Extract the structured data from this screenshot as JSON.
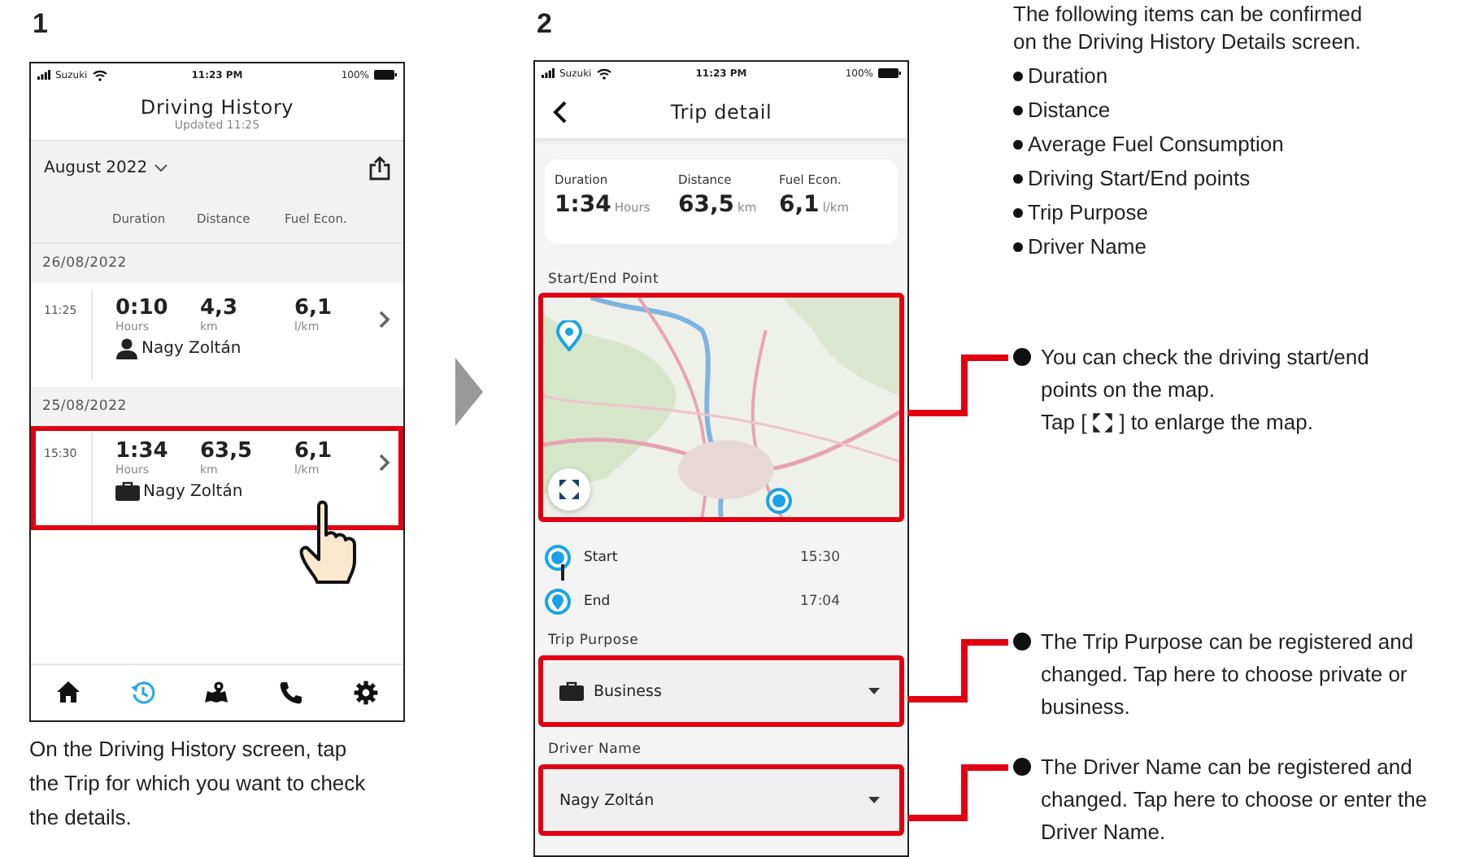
{
  "history_step": {
    "number": "1",
    "status_bar": {
      "carrier": "Suzuki",
      "time": "11:23 PM",
      "battery": "100%"
    },
    "title": "Driving History",
    "subtitle": "Updated 11:25",
    "month": "August 2022",
    "columns": [
      "Duration",
      "Distance",
      "Fuel Econ."
    ],
    "days": [
      {
        "date": "26/08/2022",
        "trips": [
          {
            "time": "11:25",
            "duration": "0:10",
            "duration_unit": "Hours",
            "distance": "4,3",
            "distance_unit": "km",
            "fuel": "6,1",
            "fuel_unit": "l/km",
            "kind": "private",
            "driver": "Nagy Zoltán",
            "highlighted": false
          }
        ]
      },
      {
        "date": "25/08/2022",
        "trips": [
          {
            "time": "15:30",
            "duration": "1:34",
            "duration_unit": "Hours",
            "distance": "63,5",
            "distance_unit": "km",
            "fuel": "6,1",
            "fuel_unit": "l/km",
            "kind": "business",
            "driver": "Nagy Zoltán",
            "highlighted": true
          }
        ]
      }
    ],
    "nav": [
      {
        "kind": "home",
        "selected": false
      },
      {
        "kind": "history",
        "selected": true
      },
      {
        "kind": "map",
        "selected": false
      },
      {
        "kind": "phone",
        "selected": false
      },
      {
        "kind": "settings",
        "selected": false
      }
    ],
    "caption": "On the Driving History screen, tap the Trip for which you want to check the details."
  },
  "detail_step": {
    "number": "2",
    "status_bar": {
      "carrier": "Suzuki",
      "time": "11:23 PM",
      "battery": "100%"
    },
    "title": "Trip detail",
    "summary": [
      {
        "label": "Duration",
        "value": "1:34",
        "unit": "Hours"
      },
      {
        "label": "Distance",
        "value": "63,5",
        "unit": "km"
      },
      {
        "label": "Fuel Econ.",
        "value": "6,1",
        "unit": "l/km"
      }
    ],
    "map_label": "Start/End Point",
    "map_highlighted": true,
    "points": [
      {
        "kind": "start",
        "label": "Start",
        "time": "15:30"
      },
      {
        "kind": "end",
        "label": "End",
        "time": "17:04"
      }
    ],
    "fields": [
      {
        "label": "Trip Purpose",
        "kind": "purpose",
        "value": "Business",
        "highlighted": true
      },
      {
        "label": "Driver Name",
        "kind": "text",
        "value": "Nagy Zoltán",
        "highlighted": true
      }
    ]
  },
  "notes": {
    "intro": "The following items can be confirmed\non the Driving History Details screen.",
    "items": [
      "Duration",
      "Distance",
      "Average Fuel Consumption",
      "Driving Start/End points",
      "Trip Purpose",
      "Driver Name"
    ],
    "callouts": [
      {
        "text": "You can check the driving start/end points on the map.",
        "hint_before": "Tap [",
        "hint_after": "] to enlarge the map."
      },
      {
        "text": "The Trip Purpose can be registered and changed. Tap here to choose private or business."
      },
      {
        "text": "The Driver Name can be registered and changed. Tap here to choose or enter the Driver Name."
      }
    ]
  }
}
